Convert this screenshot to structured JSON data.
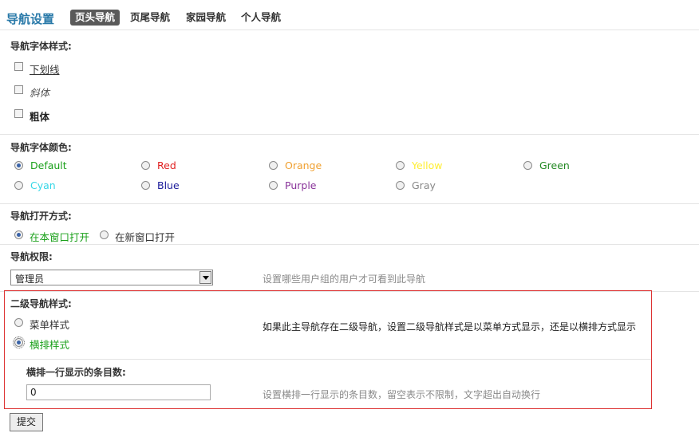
{
  "header": {
    "title": "导航设置",
    "tabs": [
      "页头导航",
      "页尾导航",
      "家园导航",
      "个人导航"
    ],
    "active_tab": "页头导航"
  },
  "font_style": {
    "label": "导航字体样式:",
    "options": [
      "下划线",
      "斜体",
      "粗体"
    ]
  },
  "font_color": {
    "label": "导航字体颜色:",
    "selected": "Default",
    "options": [
      {
        "label": "Default",
        "color": "#1aa01a"
      },
      {
        "label": "Red",
        "color": "#e02020"
      },
      {
        "label": "Orange",
        "color": "#f0a030"
      },
      {
        "label": "Yellow",
        "color": "#ffee33"
      },
      {
        "label": "Green",
        "color": "#228822"
      },
      {
        "label": "Cyan",
        "color": "#33d6e6"
      },
      {
        "label": "Blue",
        "color": "#1a1a9a"
      },
      {
        "label": "Purple",
        "color": "#883399"
      },
      {
        "label": "Gray",
        "color": "#888888"
      }
    ]
  },
  "open_mode": {
    "label": "导航打开方式:",
    "options": [
      "在本窗口打开",
      "在新窗口打开"
    ],
    "selected": "在本窗口打开"
  },
  "permission": {
    "label": "导航权限:",
    "select_value": "管理员",
    "help": "设置哪些用户组的用户才可看到此导航"
  },
  "submenu": {
    "label": "二级导航样式:",
    "options": [
      "菜单样式",
      "横排样式"
    ],
    "selected": "横排样式",
    "help": "如果此主导航存在二级导航，设置二级导航样式是以菜单方式显示，还是以横排方式显示"
  },
  "row_items": {
    "label": "横排一行显示的条目数:",
    "value": "0",
    "help": "设置横排一行显示的条目数，留空表示不限制，文字超出自动换行"
  },
  "submit_label": "提交"
}
